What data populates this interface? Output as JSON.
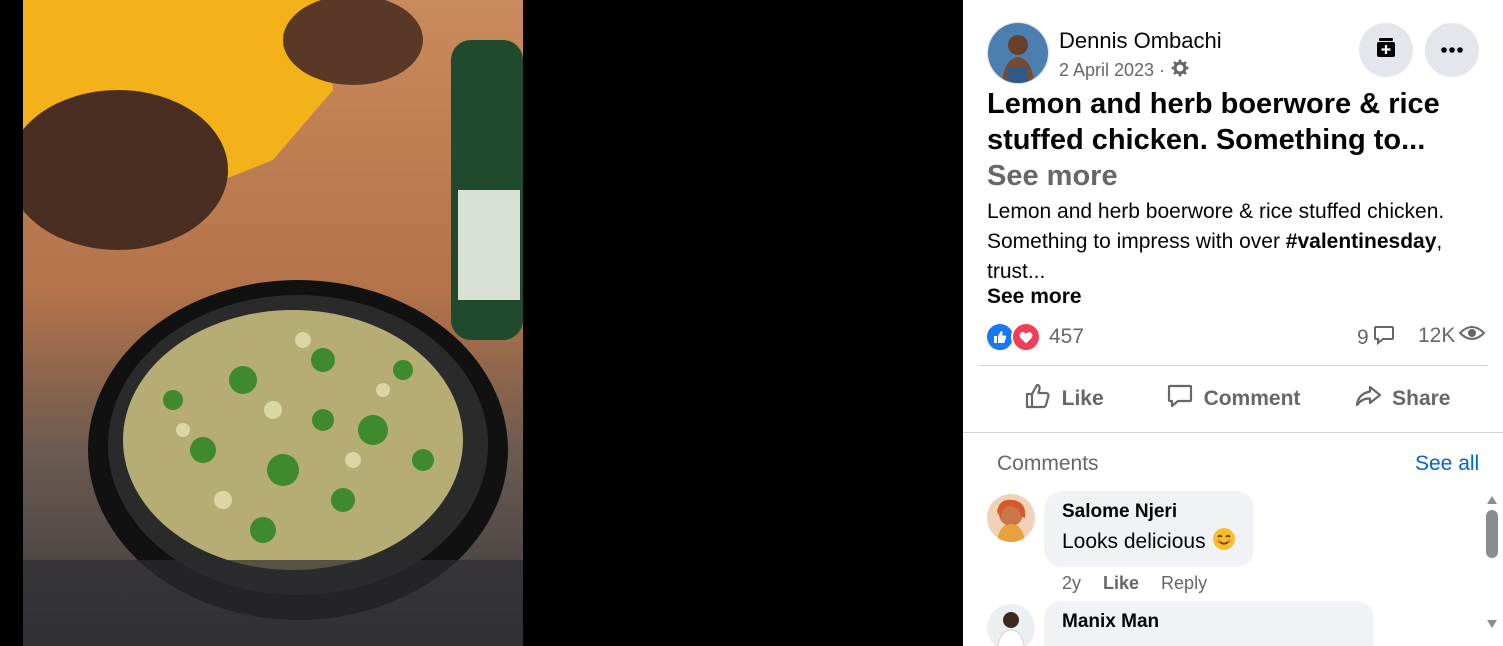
{
  "post": {
    "author": "Dennis Ombachi",
    "date": "2 April 2023 ·",
    "title": "Lemon and herb boerwore & rice stuffed chicken. Something to...",
    "title_see_more": "See more",
    "body_pre": "Lemon and herb boerwore & rice stuffed chicken. Something to impress with over ",
    "hashtag": "#valentinesday",
    "body_post": ", trust...",
    "body_see_more": "See more",
    "reaction_count": "457",
    "comment_count": "9",
    "view_count": "12K"
  },
  "actions": {
    "like": "Like",
    "comment": "Comment",
    "share": "Share"
  },
  "comments_section": {
    "heading": "Comments",
    "see_all": "See all",
    "items": [
      {
        "author": "Salome Njeri",
        "text": "Looks delicious",
        "time": "2y",
        "like": "Like",
        "reply": "Reply"
      },
      {
        "author": "Manix Man"
      }
    ]
  },
  "colors": {
    "like_blue": "#1877f2",
    "love_red": "#f33e58",
    "link_blue": "#0064d1",
    "muted_gray": "#65676b"
  },
  "icons": [
    "gear-icon",
    "save-icon",
    "more-icon",
    "like-reaction-icon",
    "love-reaction-icon",
    "comment-bubble-icon",
    "eye-icon",
    "thumbs-up-icon",
    "share-arrow-icon",
    "smile-emoji-icon"
  ]
}
